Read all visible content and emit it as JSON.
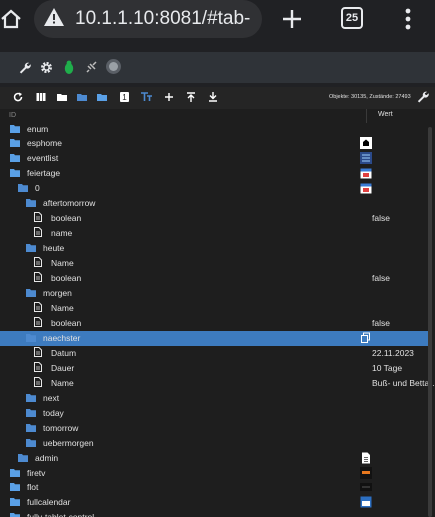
{
  "browser": {
    "url": "10.1.1.10:8081/#tab-",
    "tab_count": "25"
  },
  "tree_toolbar": {
    "stats": "Objekte: 30135, Zustände: 27493"
  },
  "columns": {
    "id": "ID",
    "value": "Wert"
  },
  "rows": [
    {
      "label": "enum",
      "type": "folder",
      "level": 0
    },
    {
      "label": "esphome",
      "type": "folder",
      "level": 0,
      "value_icon": "esphome-logo-icon"
    },
    {
      "label": "eventlist",
      "type": "folder",
      "level": 0,
      "value_icon": "list-icon"
    },
    {
      "label": "feiertage",
      "type": "folder",
      "level": 0,
      "value_icon": "calendar-icon"
    },
    {
      "label": "0",
      "type": "folder",
      "level": 1,
      "value_icon": "calendar-icon"
    },
    {
      "label": "aftertomorrow",
      "type": "folder",
      "level": 2
    },
    {
      "label": "boolean",
      "type": "state",
      "level": 3,
      "value": "false"
    },
    {
      "label": "name",
      "type": "state",
      "level": 3
    },
    {
      "label": "heute",
      "type": "folder",
      "level": 2
    },
    {
      "label": "Name",
      "type": "state",
      "level": 3
    },
    {
      "label": "boolean",
      "type": "state",
      "level": 3,
      "value": "false"
    },
    {
      "label": "morgen",
      "type": "folder",
      "level": 2
    },
    {
      "label": "Name",
      "type": "state",
      "level": 3
    },
    {
      "label": "boolean",
      "type": "state",
      "level": 3,
      "value": "false"
    },
    {
      "label": "naechster",
      "type": "folder",
      "level": 2,
      "selected": true,
      "value_icon": "copy-icon"
    },
    {
      "label": "Datum",
      "type": "state",
      "level": 3,
      "value": "22.11.2023"
    },
    {
      "label": "Dauer",
      "type": "state",
      "level": 3,
      "value": "10 Tage"
    },
    {
      "label": "Name",
      "type": "state",
      "level": 3,
      "value": "Buß- und Betta…"
    },
    {
      "label": "next",
      "type": "folder",
      "level": 2
    },
    {
      "label": "today",
      "type": "folder",
      "level": 2
    },
    {
      "label": "tomorrow",
      "type": "folder",
      "level": 2
    },
    {
      "label": "uebermorgen",
      "type": "folder",
      "level": 2
    },
    {
      "label": "admin",
      "type": "folder",
      "level": 1,
      "value_icon": "document-icon"
    },
    {
      "label": "firetv",
      "type": "folder",
      "level": 0,
      "value_icon": "firetv-logo-icon"
    },
    {
      "label": "flot",
      "type": "folder",
      "level": 0,
      "value_icon": "flot-logo-icon"
    },
    {
      "label": "fullcalendar",
      "type": "folder",
      "level": 0,
      "value_icon": "fullcalendar-icon"
    },
    {
      "label": "fully-tablet-control",
      "type": "folder",
      "level": 0
    }
  ],
  "colors": {
    "folder_open": "#4d8ad0",
    "folder_closed": "#5aa0e6",
    "selected_row": "#3d7bbf",
    "background": "#1e1e1e"
  }
}
